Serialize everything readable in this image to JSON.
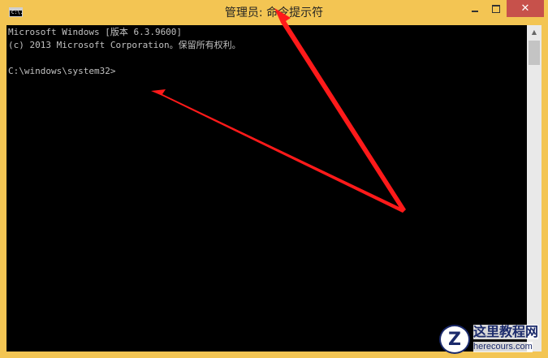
{
  "window": {
    "title": "管理员: 命令提示符",
    "icon": "cmd-icon",
    "icon_text": "C:\\.",
    "controls": {
      "minimize": "minimize-icon",
      "maximize": "maximize-icon",
      "close": "close-icon",
      "close_glyph": "✕"
    }
  },
  "console": {
    "lines": [
      "Microsoft Windows [版本 6.3.9600]",
      "(c) 2013 Microsoft Corporation。保留所有权利。",
      "",
      "C:\\windows\\system32>"
    ]
  },
  "scrollbar": {
    "up_glyph": "▲"
  },
  "watermark": {
    "title": "这里教程网",
    "url": "herecours.com",
    "logo_letter": "Z"
  },
  "colors": {
    "frame": "#f3c553",
    "console_bg": "#000000",
    "console_text": "#c0c0c0",
    "close_button": "#c7514b",
    "annotation_arrow": "#ff1a1a"
  }
}
